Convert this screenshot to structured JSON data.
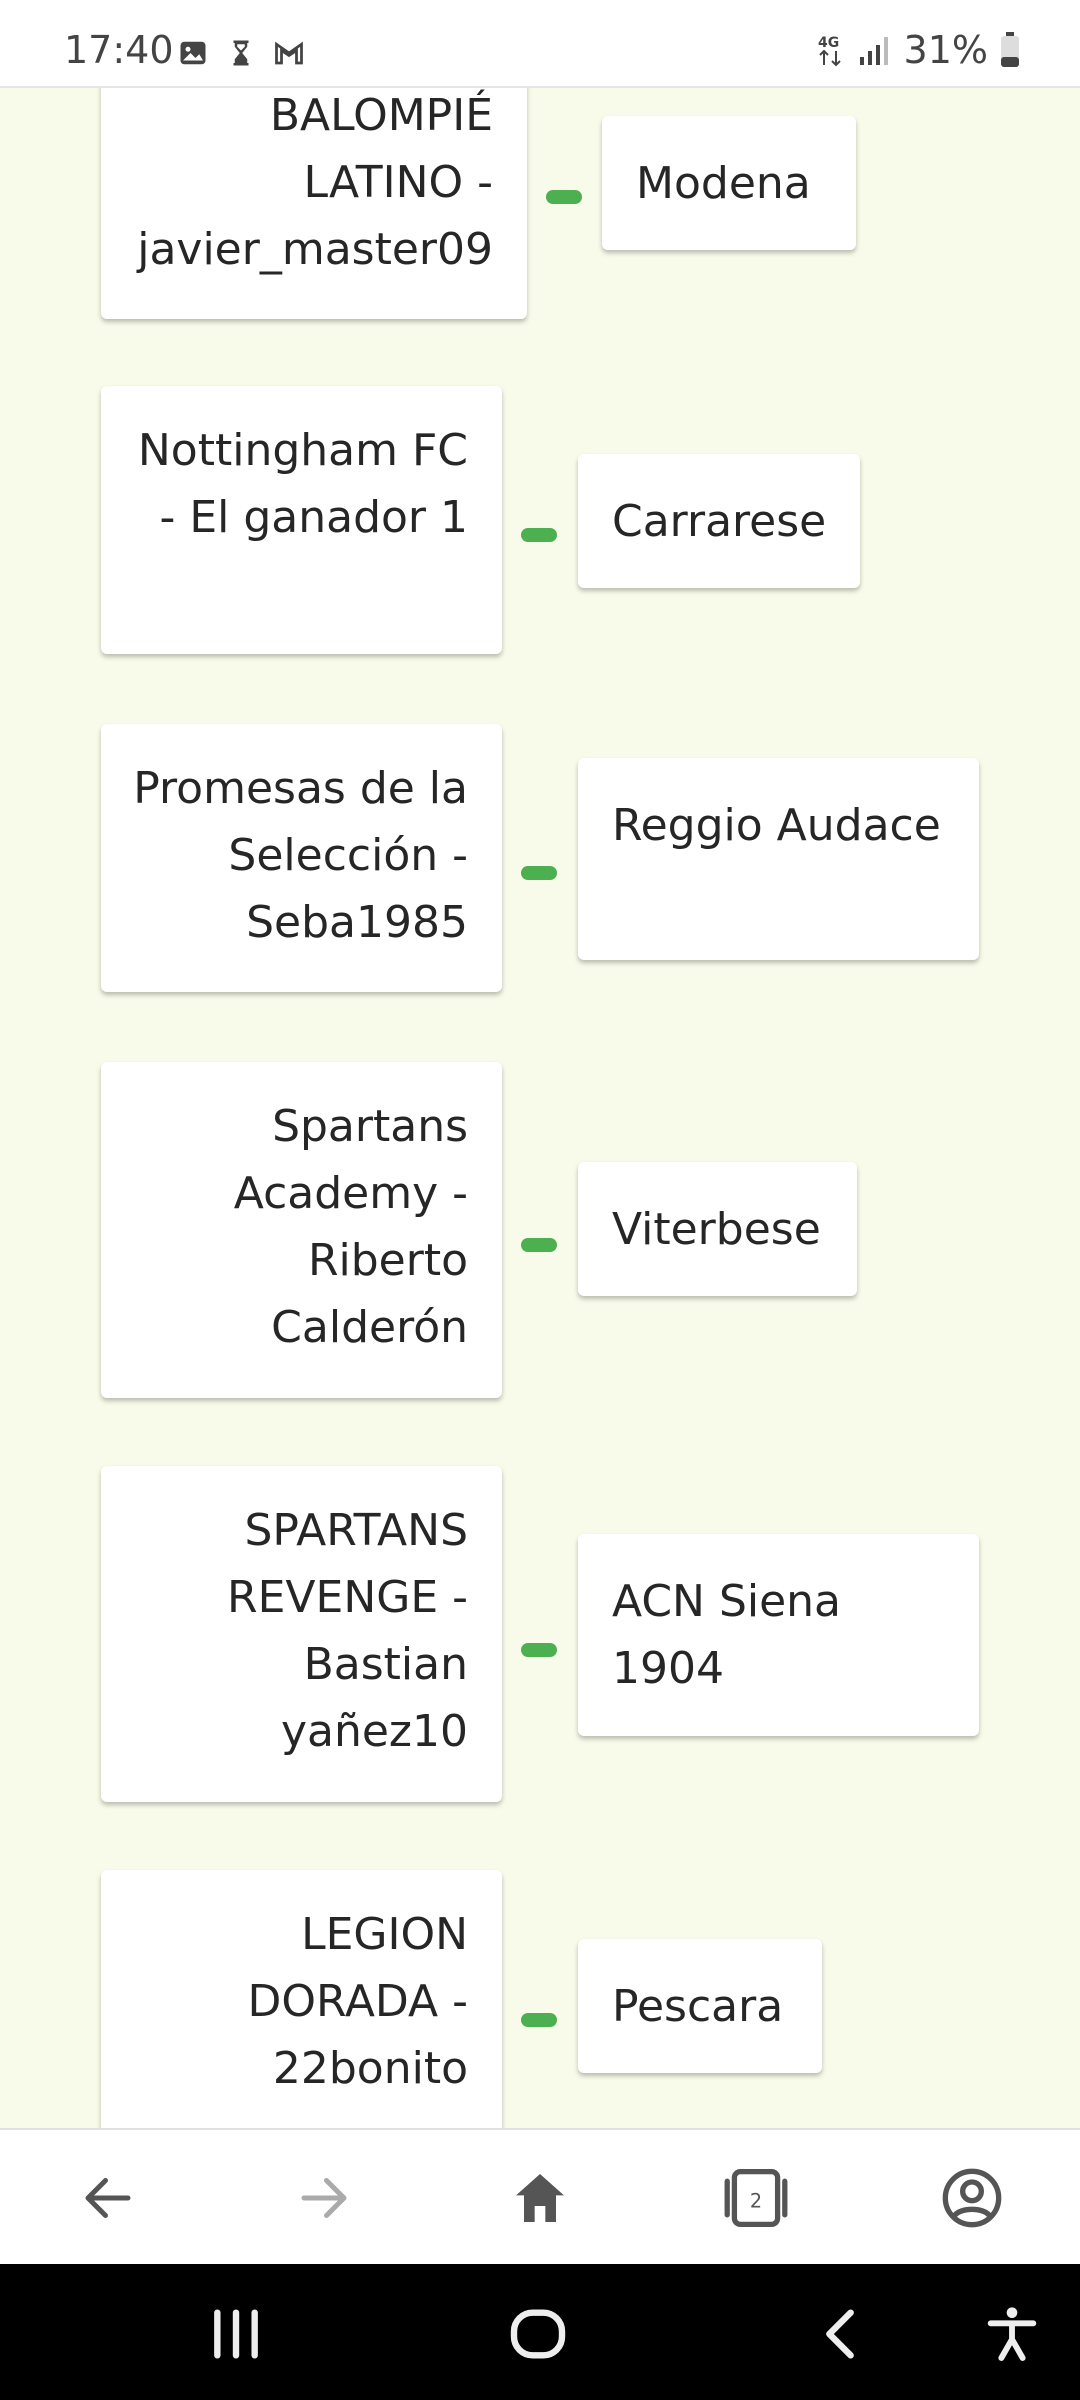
{
  "status_bar": {
    "time": "17:40",
    "left_icons": [
      "image-icon",
      "hourglass-icon",
      "gmail-icon"
    ],
    "network": "4G",
    "battery": "31%"
  },
  "fixtures": [
    {
      "home": "BALOMPIÉ LATINO - javier_master09",
      "away": "Modena"
    },
    {
      "home": "Nottingham FC - El ganador 1",
      "away": "Carrarese"
    },
    {
      "home": "Promesas de la Selección - Seba1985",
      "away": "Reggio Audace"
    },
    {
      "home": "Spartans Academy - Riberto Calderón",
      "away": "Viterbese"
    },
    {
      "home": "SPARTANS REVENGE - Bastian yañez10",
      "away": "ACN Siena 1904"
    },
    {
      "home": "LEGION DORADA - 22bonito",
      "away": "Pescara"
    }
  ],
  "browser_nav": {
    "tab_count": "2",
    "icons": [
      "back-arrow-icon",
      "forward-arrow-icon",
      "home-icon",
      "tabs-icon",
      "account-icon"
    ]
  },
  "system_nav": {
    "icons": [
      "recent-apps-icon",
      "home-circle-icon",
      "back-icon",
      "accessibility-icon"
    ]
  },
  "colors": {
    "background": "#f8fbe9",
    "dash": "#4caf50",
    "card": "#ffffff"
  }
}
